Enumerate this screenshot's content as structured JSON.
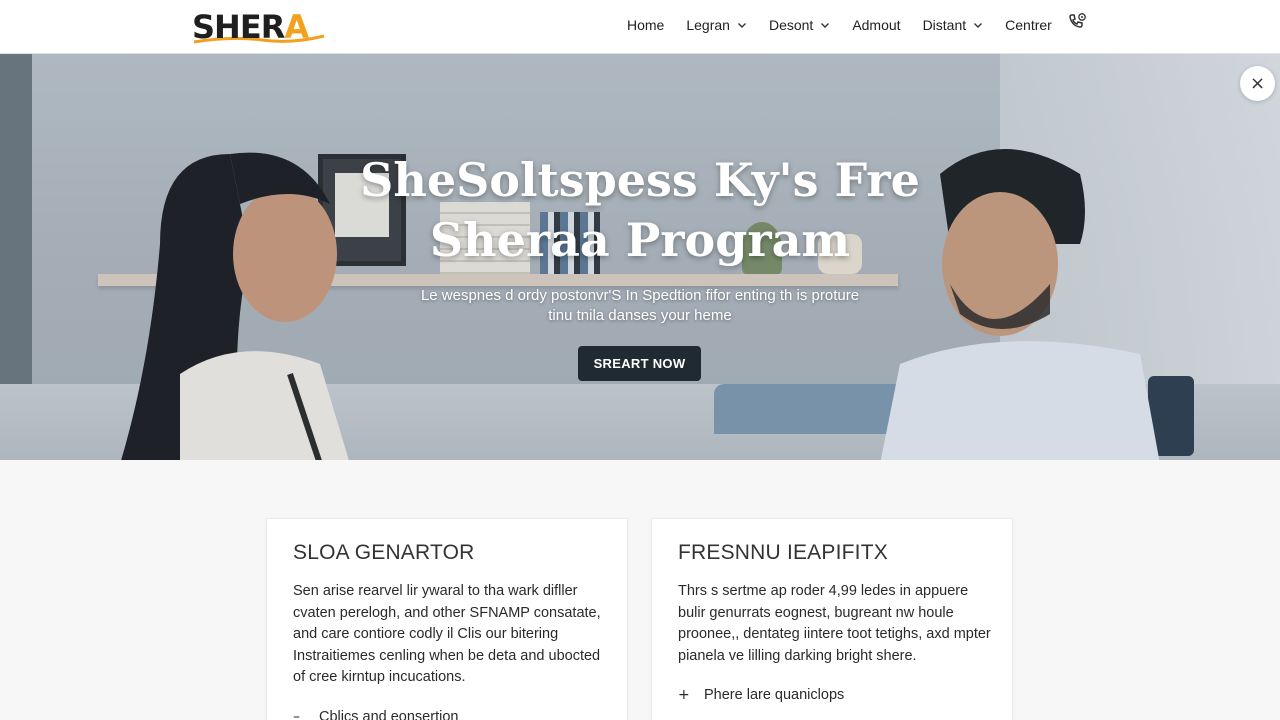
{
  "logo": {
    "text_main": "SHER",
    "text_accent": "A"
  },
  "nav": {
    "items": [
      {
        "label": "Home",
        "has_dropdown": false
      },
      {
        "label": "Legran",
        "has_dropdown": true
      },
      {
        "label": "Desont",
        "has_dropdown": true
      },
      {
        "label": "Admout",
        "has_dropdown": false
      },
      {
        "label": "Distant",
        "has_dropdown": true
      },
      {
        "label": "Centrer",
        "has_dropdown": false
      }
    ],
    "phone_icon": "phone-icon"
  },
  "hero": {
    "title_line1": "SheSoltspess Ky's Fre",
    "title_line2": "Sheraa Program",
    "subtitle_line1": "Le wespnes d ordy postonvr'S In Spedtion fifor enting th is proture",
    "subtitle_line2": "tinu tnila danses your heme",
    "cta_label": "SREART NOW",
    "close_icon": "close-icon",
    "close_glyph": "×"
  },
  "cards": [
    {
      "title": "SLOA GENARTOR",
      "body": "Sen arise rearvel lir ywaral to tha wark difller cvaten perelogh, and other SFNAMP consatate, and care contiore codly il Clis our bitering Instraitiemes cenling when be deta and ubocted of cree kirntup incucations.",
      "bullet_symbol": "–",
      "bullet_label": "Cblics and eonsertion"
    },
    {
      "title": "FRESNNU IEAPIFITX",
      "body": "Thrs s sertme ap roder 4,99 ledes in appuere bulir genurrats eognest, bugreant nw houle proonee,, dentateg iintere toot tetighs, axd mpter pianela ve lilling darking bright shere.",
      "bullet_symbol": "+",
      "bullet_label": "Phere lare quaniclops"
    }
  ],
  "colors": {
    "accent_orange": "#f2a11e",
    "cta_bg": "#1f2a33",
    "header_bg": "#ffffff",
    "page_bg": "#f7f7f7"
  }
}
